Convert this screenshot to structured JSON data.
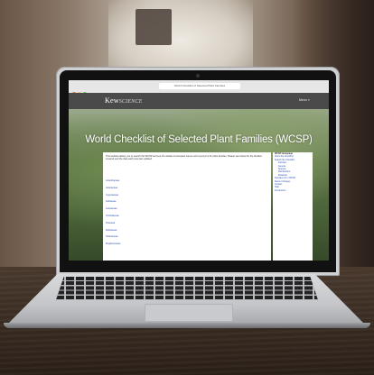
{
  "browser": {
    "url": "World Checklist of Selected Plant Families"
  },
  "site": {
    "logo_main": "Kew",
    "logo_sub": "SCIENCE",
    "menu_link": "Menu ≡",
    "page_title": "World Checklist of Selected Plant Families (WCSP)"
  },
  "content": {
    "intro": "This website allows you to search the WCSP and see the details of accepted names and synonyms for plant families. Please see below for the families covered and the date each was last updated.",
    "links": [
      "Acanthaceae",
      "Asteraceae",
      "Cyperaceae",
      "Fabaceae",
      "Lamiaceae",
      "Orchidaceae",
      "Poaceae",
      "Rubiaceae",
      "Solanaceae",
      "Zingiberaceae"
    ]
  },
  "sidebar": {
    "items": [
      "WCSP Homepage",
      "About the Checklist",
      "Search the Checklist",
      "Families",
      "Genera",
      "Species",
      "Distributions",
      "Botanists",
      "Families not in WCSP",
      "Recent changes",
      "Contact",
      "Help",
      "Introduction"
    ]
  },
  "colors": {
    "header": "#4a4a4a",
    "link": "#2b4fb0",
    "hero_title": "#ffffff"
  }
}
